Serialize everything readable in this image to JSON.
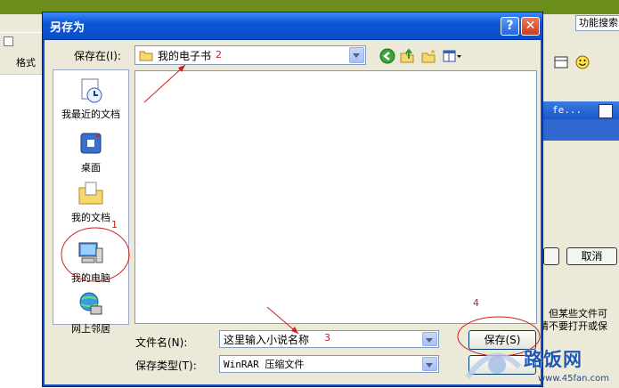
{
  "background_app": {
    "function_search": "功能搜索",
    "format_label": "格式",
    "window_title": "fe...",
    "cancel_label": "取消",
    "note_line1": "，但某些文件可",
    "note_line2": "请不要打开或保"
  },
  "dialog": {
    "title": "另存为",
    "help_label": "?",
    "close_label": "✕",
    "save_in_label": "保存在(I):",
    "save_in_value": "我的电子书",
    "file_name_label": "文件名(N):",
    "file_name_value": "这里输入小说名称",
    "file_type_label": "保存类型(T):",
    "file_type_value": "WinRAR 压缩文件",
    "save_button": "保存(S)",
    "places": [
      {
        "label": "我最近的文档",
        "icon": "recent-documents-icon"
      },
      {
        "label": "桌面",
        "icon": "desktop-icon"
      },
      {
        "label": "我的文档",
        "icon": "my-documents-icon"
      },
      {
        "label": "我的电脑",
        "icon": "my-computer-icon"
      },
      {
        "label": "网上邻居",
        "icon": "network-places-icon"
      }
    ]
  },
  "annotations": {
    "n1": "1",
    "n2": "2",
    "n3": "3",
    "n4": "4"
  },
  "watermark": {
    "text": "路饭网",
    "url": "www.45fan.com"
  },
  "colors": {
    "titlebar": "#0c57d8",
    "annotation": "#d02020",
    "dialog_bg": "#ece9d8",
    "bg_topbar": "#6a8d1c"
  }
}
